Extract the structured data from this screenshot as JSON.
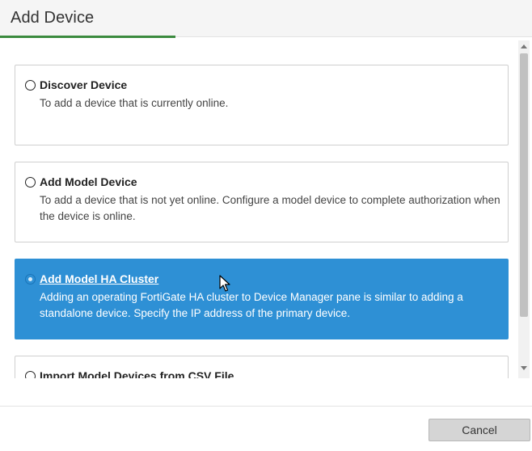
{
  "dialog": {
    "title": "Add Device",
    "progress_fraction": 0.33
  },
  "options": [
    {
      "title": "Discover Device",
      "description": "To add a device that is currently online.",
      "selected": false
    },
    {
      "title": "Add Model Device",
      "description": "To add a device that is not yet online. Configure a model device to complete authorization when the device is online.",
      "selected": false
    },
    {
      "title": "Add Model HA Cluster",
      "description": "Adding an operating FortiGate HA cluster to Device Manager pane is similar to adding a standalone device. Specify the IP address of the primary device.",
      "selected": true
    },
    {
      "title": "Import Model Devices from CSV File",
      "description": "",
      "selected": false
    }
  ],
  "footer": {
    "cancel_label": "Cancel"
  },
  "colors": {
    "accent_green": "#3b8a3e",
    "selected_blue": "#2e90d5"
  },
  "icons": {
    "cursor": "mouse-pointer-icon"
  }
}
